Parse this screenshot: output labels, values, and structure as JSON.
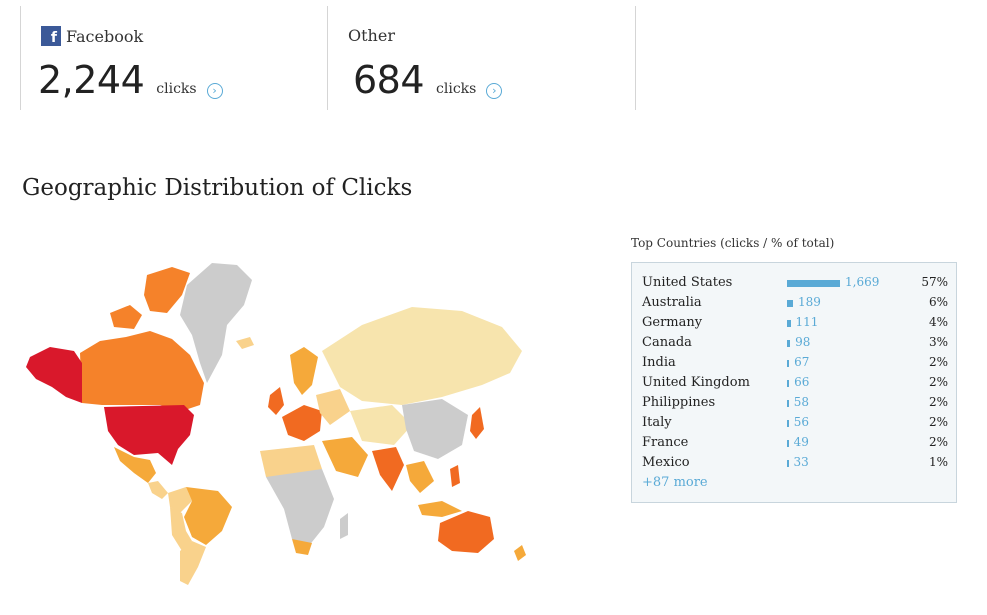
{
  "cards": [
    {
      "label": "Facebook",
      "icon": "facebook-icon",
      "value": "2,244",
      "unit": "clicks"
    },
    {
      "label": "Other",
      "value": "684",
      "unit": "clicks"
    }
  ],
  "section_title": "Geographic Distribution of Clicks",
  "top_countries": {
    "title": "Top Countries (clicks / % of total)",
    "rows": [
      {
        "country": "United States",
        "clicks": "1,669",
        "clicks_num": 1669,
        "pct": "57%"
      },
      {
        "country": "Australia",
        "clicks": "189",
        "clicks_num": 189,
        "pct": "6%"
      },
      {
        "country": "Germany",
        "clicks": "111",
        "clicks_num": 111,
        "pct": "4%"
      },
      {
        "country": "Canada",
        "clicks": "98",
        "clicks_num": 98,
        "pct": "3%"
      },
      {
        "country": "India",
        "clicks": "67",
        "clicks_num": 67,
        "pct": "2%"
      },
      {
        "country": "United Kingdom",
        "clicks": "66",
        "clicks_num": 66,
        "pct": "2%"
      },
      {
        "country": "Philippines",
        "clicks": "58",
        "clicks_num": 58,
        "pct": "2%"
      },
      {
        "country": "Italy",
        "clicks": "56",
        "clicks_num": 56,
        "pct": "2%"
      },
      {
        "country": "France",
        "clicks": "49",
        "clicks_num": 49,
        "pct": "2%"
      },
      {
        "country": "Mexico",
        "clicks": "33",
        "clicks_num": 33,
        "pct": "1%"
      }
    ],
    "more": "+87 more"
  },
  "colors": {
    "accent": "#5aaad6",
    "facebook": "#3b5998",
    "map_top": "#d9182b",
    "map_high": "#f16a21",
    "map_mid": "#f5a93a",
    "map_low": "#f9d28c",
    "map_lowest": "#f7e4ad",
    "map_none": "#cccccc"
  }
}
